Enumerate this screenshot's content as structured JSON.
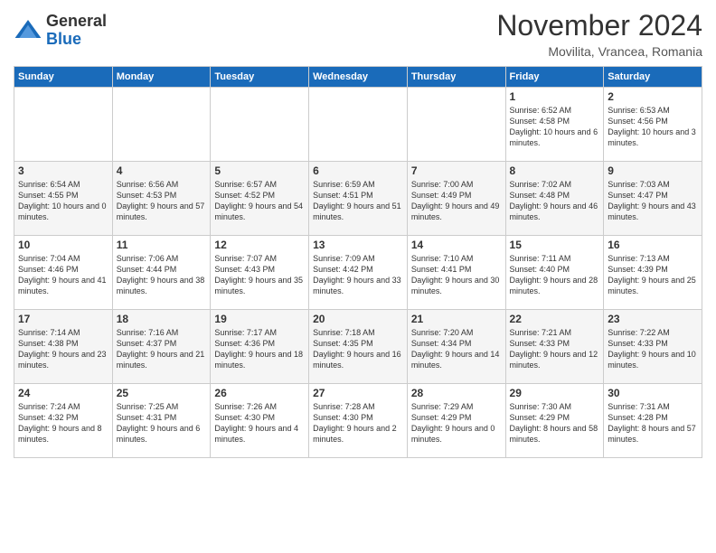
{
  "header": {
    "logo_general": "General",
    "logo_blue": "Blue",
    "title": "November 2024",
    "location": "Movilita, Vrancea, Romania"
  },
  "weekdays": [
    "Sunday",
    "Monday",
    "Tuesday",
    "Wednesday",
    "Thursday",
    "Friday",
    "Saturday"
  ],
  "weeks": [
    [
      {
        "day": "",
        "info": ""
      },
      {
        "day": "",
        "info": ""
      },
      {
        "day": "",
        "info": ""
      },
      {
        "day": "",
        "info": ""
      },
      {
        "day": "",
        "info": ""
      },
      {
        "day": "1",
        "info": "Sunrise: 6:52 AM\nSunset: 4:58 PM\nDaylight: 10 hours and 6 minutes."
      },
      {
        "day": "2",
        "info": "Sunrise: 6:53 AM\nSunset: 4:56 PM\nDaylight: 10 hours and 3 minutes."
      }
    ],
    [
      {
        "day": "3",
        "info": "Sunrise: 6:54 AM\nSunset: 4:55 PM\nDaylight: 10 hours and 0 minutes."
      },
      {
        "day": "4",
        "info": "Sunrise: 6:56 AM\nSunset: 4:53 PM\nDaylight: 9 hours and 57 minutes."
      },
      {
        "day": "5",
        "info": "Sunrise: 6:57 AM\nSunset: 4:52 PM\nDaylight: 9 hours and 54 minutes."
      },
      {
        "day": "6",
        "info": "Sunrise: 6:59 AM\nSunset: 4:51 PM\nDaylight: 9 hours and 51 minutes."
      },
      {
        "day": "7",
        "info": "Sunrise: 7:00 AM\nSunset: 4:49 PM\nDaylight: 9 hours and 49 minutes."
      },
      {
        "day": "8",
        "info": "Sunrise: 7:02 AM\nSunset: 4:48 PM\nDaylight: 9 hours and 46 minutes."
      },
      {
        "day": "9",
        "info": "Sunrise: 7:03 AM\nSunset: 4:47 PM\nDaylight: 9 hours and 43 minutes."
      }
    ],
    [
      {
        "day": "10",
        "info": "Sunrise: 7:04 AM\nSunset: 4:46 PM\nDaylight: 9 hours and 41 minutes."
      },
      {
        "day": "11",
        "info": "Sunrise: 7:06 AM\nSunset: 4:44 PM\nDaylight: 9 hours and 38 minutes."
      },
      {
        "day": "12",
        "info": "Sunrise: 7:07 AM\nSunset: 4:43 PM\nDaylight: 9 hours and 35 minutes."
      },
      {
        "day": "13",
        "info": "Sunrise: 7:09 AM\nSunset: 4:42 PM\nDaylight: 9 hours and 33 minutes."
      },
      {
        "day": "14",
        "info": "Sunrise: 7:10 AM\nSunset: 4:41 PM\nDaylight: 9 hours and 30 minutes."
      },
      {
        "day": "15",
        "info": "Sunrise: 7:11 AM\nSunset: 4:40 PM\nDaylight: 9 hours and 28 minutes."
      },
      {
        "day": "16",
        "info": "Sunrise: 7:13 AM\nSunset: 4:39 PM\nDaylight: 9 hours and 25 minutes."
      }
    ],
    [
      {
        "day": "17",
        "info": "Sunrise: 7:14 AM\nSunset: 4:38 PM\nDaylight: 9 hours and 23 minutes."
      },
      {
        "day": "18",
        "info": "Sunrise: 7:16 AM\nSunset: 4:37 PM\nDaylight: 9 hours and 21 minutes."
      },
      {
        "day": "19",
        "info": "Sunrise: 7:17 AM\nSunset: 4:36 PM\nDaylight: 9 hours and 18 minutes."
      },
      {
        "day": "20",
        "info": "Sunrise: 7:18 AM\nSunset: 4:35 PM\nDaylight: 9 hours and 16 minutes."
      },
      {
        "day": "21",
        "info": "Sunrise: 7:20 AM\nSunset: 4:34 PM\nDaylight: 9 hours and 14 minutes."
      },
      {
        "day": "22",
        "info": "Sunrise: 7:21 AM\nSunset: 4:33 PM\nDaylight: 9 hours and 12 minutes."
      },
      {
        "day": "23",
        "info": "Sunrise: 7:22 AM\nSunset: 4:33 PM\nDaylight: 9 hours and 10 minutes."
      }
    ],
    [
      {
        "day": "24",
        "info": "Sunrise: 7:24 AM\nSunset: 4:32 PM\nDaylight: 9 hours and 8 minutes."
      },
      {
        "day": "25",
        "info": "Sunrise: 7:25 AM\nSunset: 4:31 PM\nDaylight: 9 hours and 6 minutes."
      },
      {
        "day": "26",
        "info": "Sunrise: 7:26 AM\nSunset: 4:30 PM\nDaylight: 9 hours and 4 minutes."
      },
      {
        "day": "27",
        "info": "Sunrise: 7:28 AM\nSunset: 4:30 PM\nDaylight: 9 hours and 2 minutes."
      },
      {
        "day": "28",
        "info": "Sunrise: 7:29 AM\nSunset: 4:29 PM\nDaylight: 9 hours and 0 minutes."
      },
      {
        "day": "29",
        "info": "Sunrise: 7:30 AM\nSunset: 4:29 PM\nDaylight: 8 hours and 58 minutes."
      },
      {
        "day": "30",
        "info": "Sunrise: 7:31 AM\nSunset: 4:28 PM\nDaylight: 8 hours and 57 minutes."
      }
    ]
  ]
}
